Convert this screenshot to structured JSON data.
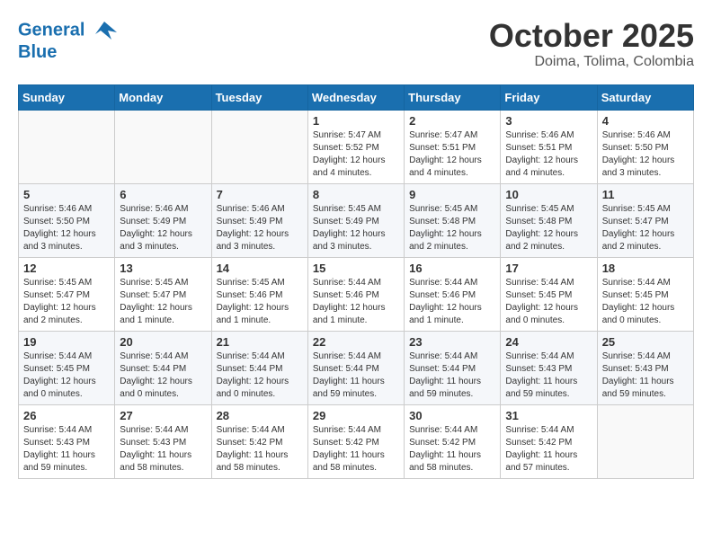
{
  "header": {
    "logo_line1": "General",
    "logo_line2": "Blue",
    "month": "October 2025",
    "location": "Doima, Tolima, Colombia"
  },
  "weekdays": [
    "Sunday",
    "Monday",
    "Tuesday",
    "Wednesday",
    "Thursday",
    "Friday",
    "Saturday"
  ],
  "weeks": [
    [
      {
        "day": "",
        "info": ""
      },
      {
        "day": "",
        "info": ""
      },
      {
        "day": "",
        "info": ""
      },
      {
        "day": "1",
        "info": "Sunrise: 5:47 AM\nSunset: 5:52 PM\nDaylight: 12 hours\nand 4 minutes."
      },
      {
        "day": "2",
        "info": "Sunrise: 5:47 AM\nSunset: 5:51 PM\nDaylight: 12 hours\nand 4 minutes."
      },
      {
        "day": "3",
        "info": "Sunrise: 5:46 AM\nSunset: 5:51 PM\nDaylight: 12 hours\nand 4 minutes."
      },
      {
        "day": "4",
        "info": "Sunrise: 5:46 AM\nSunset: 5:50 PM\nDaylight: 12 hours\nand 3 minutes."
      }
    ],
    [
      {
        "day": "5",
        "info": "Sunrise: 5:46 AM\nSunset: 5:50 PM\nDaylight: 12 hours\nand 3 minutes."
      },
      {
        "day": "6",
        "info": "Sunrise: 5:46 AM\nSunset: 5:49 PM\nDaylight: 12 hours\nand 3 minutes."
      },
      {
        "day": "7",
        "info": "Sunrise: 5:46 AM\nSunset: 5:49 PM\nDaylight: 12 hours\nand 3 minutes."
      },
      {
        "day": "8",
        "info": "Sunrise: 5:45 AM\nSunset: 5:49 PM\nDaylight: 12 hours\nand 3 minutes."
      },
      {
        "day": "9",
        "info": "Sunrise: 5:45 AM\nSunset: 5:48 PM\nDaylight: 12 hours\nand 2 minutes."
      },
      {
        "day": "10",
        "info": "Sunrise: 5:45 AM\nSunset: 5:48 PM\nDaylight: 12 hours\nand 2 minutes."
      },
      {
        "day": "11",
        "info": "Sunrise: 5:45 AM\nSunset: 5:47 PM\nDaylight: 12 hours\nand 2 minutes."
      }
    ],
    [
      {
        "day": "12",
        "info": "Sunrise: 5:45 AM\nSunset: 5:47 PM\nDaylight: 12 hours\nand 2 minutes."
      },
      {
        "day": "13",
        "info": "Sunrise: 5:45 AM\nSunset: 5:47 PM\nDaylight: 12 hours\nand 1 minute."
      },
      {
        "day": "14",
        "info": "Sunrise: 5:45 AM\nSunset: 5:46 PM\nDaylight: 12 hours\nand 1 minute."
      },
      {
        "day": "15",
        "info": "Sunrise: 5:44 AM\nSunset: 5:46 PM\nDaylight: 12 hours\nand 1 minute."
      },
      {
        "day": "16",
        "info": "Sunrise: 5:44 AM\nSunset: 5:46 PM\nDaylight: 12 hours\nand 1 minute."
      },
      {
        "day": "17",
        "info": "Sunrise: 5:44 AM\nSunset: 5:45 PM\nDaylight: 12 hours\nand 0 minutes."
      },
      {
        "day": "18",
        "info": "Sunrise: 5:44 AM\nSunset: 5:45 PM\nDaylight: 12 hours\nand 0 minutes."
      }
    ],
    [
      {
        "day": "19",
        "info": "Sunrise: 5:44 AM\nSunset: 5:45 PM\nDaylight: 12 hours\nand 0 minutes."
      },
      {
        "day": "20",
        "info": "Sunrise: 5:44 AM\nSunset: 5:44 PM\nDaylight: 12 hours\nand 0 minutes."
      },
      {
        "day": "21",
        "info": "Sunrise: 5:44 AM\nSunset: 5:44 PM\nDaylight: 12 hours\nand 0 minutes."
      },
      {
        "day": "22",
        "info": "Sunrise: 5:44 AM\nSunset: 5:44 PM\nDaylight: 11 hours\nand 59 minutes."
      },
      {
        "day": "23",
        "info": "Sunrise: 5:44 AM\nSunset: 5:44 PM\nDaylight: 11 hours\nand 59 minutes."
      },
      {
        "day": "24",
        "info": "Sunrise: 5:44 AM\nSunset: 5:43 PM\nDaylight: 11 hours\nand 59 minutes."
      },
      {
        "day": "25",
        "info": "Sunrise: 5:44 AM\nSunset: 5:43 PM\nDaylight: 11 hours\nand 59 minutes."
      }
    ],
    [
      {
        "day": "26",
        "info": "Sunrise: 5:44 AM\nSunset: 5:43 PM\nDaylight: 11 hours\nand 59 minutes."
      },
      {
        "day": "27",
        "info": "Sunrise: 5:44 AM\nSunset: 5:43 PM\nDaylight: 11 hours\nand 58 minutes."
      },
      {
        "day": "28",
        "info": "Sunrise: 5:44 AM\nSunset: 5:42 PM\nDaylight: 11 hours\nand 58 minutes."
      },
      {
        "day": "29",
        "info": "Sunrise: 5:44 AM\nSunset: 5:42 PM\nDaylight: 11 hours\nand 58 minutes."
      },
      {
        "day": "30",
        "info": "Sunrise: 5:44 AM\nSunset: 5:42 PM\nDaylight: 11 hours\nand 58 minutes."
      },
      {
        "day": "31",
        "info": "Sunrise: 5:44 AM\nSunset: 5:42 PM\nDaylight: 11 hours\nand 57 minutes."
      },
      {
        "day": "",
        "info": ""
      }
    ]
  ]
}
